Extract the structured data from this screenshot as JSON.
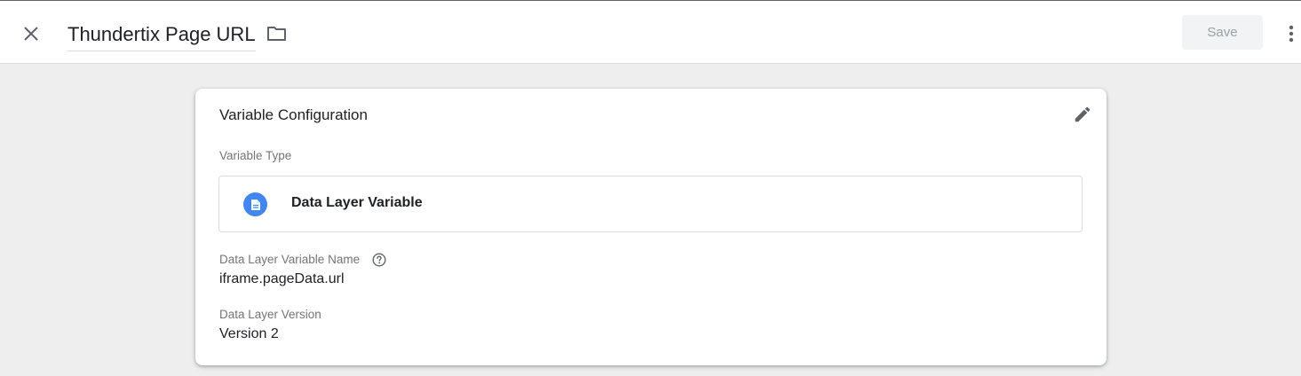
{
  "header": {
    "title": "Thundertix Page URL",
    "save_label": "Save",
    "icons": {
      "close": "close-icon",
      "folder": "folder-icon",
      "more": "more-vert-icon"
    }
  },
  "card": {
    "title": "Variable Configuration",
    "edit_icon": "pencil-icon",
    "variable_type": {
      "label": "Variable Type",
      "value": "Data Layer Variable",
      "icon": "document-icon",
      "icon_color": "#4285f4"
    },
    "dlv_name": {
      "label": "Data Layer Variable Name",
      "value": "iframe.pageData.url",
      "help_icon": "help-icon"
    },
    "dl_version": {
      "label": "Data Layer Version",
      "value": "Version 2"
    }
  },
  "colors": {
    "background": "#eeeeee",
    "card": "#ffffff",
    "accent": "#4285f4",
    "muted_text": "#757575"
  }
}
